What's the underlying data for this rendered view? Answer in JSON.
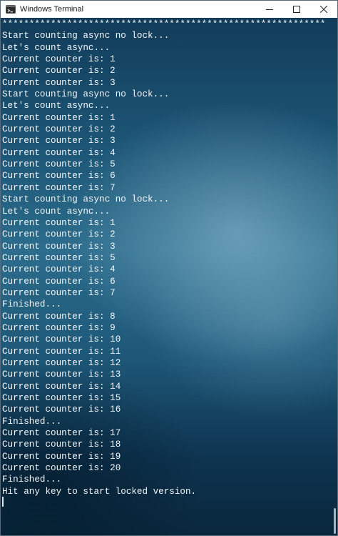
{
  "window": {
    "title": "Windows Terminal",
    "icon": "terminal-icon",
    "controls": {
      "minimize": "minimize-icon",
      "maximize": "maximize-icon",
      "close": "close-icon"
    }
  },
  "terminal": {
    "lines": [
      "************************************************************",
      "Start counting async no lock...",
      "Let's count async...",
      "Current counter is: 1",
      "Current counter is: 2",
      "Current counter is: 3",
      "Start counting async no lock...",
      "Let's count async...",
      "Current counter is: 1",
      "Current counter is: 2",
      "Current counter is: 3",
      "Current counter is: 4",
      "Current counter is: 5",
      "Current counter is: 6",
      "Current counter is: 7",
      "Start counting async no lock...",
      "Let's count async...",
      "Current counter is: 1",
      "Current counter is: 2",
      "Current counter is: 3",
      "Current counter is: 5",
      "Current counter is: 4",
      "Current counter is: 6",
      "Current counter is: 7",
      "Finished...",
      "Current counter is: 8",
      "Current counter is: 9",
      "Current counter is: 10",
      "Current counter is: 11",
      "Current counter is: 12",
      "Current counter is: 13",
      "Current counter is: 14",
      "Current counter is: 15",
      "Current counter is: 16",
      "Finished...",
      "Current counter is: 17",
      "Current counter is: 18",
      "Current counter is: 19",
      "Current counter is: 20",
      "Finished...",
      "Hit any key to start locked version."
    ]
  },
  "colors": {
    "text": "#f4f7f9",
    "titlebar": "#ffffff",
    "background": "#1d5676"
  }
}
